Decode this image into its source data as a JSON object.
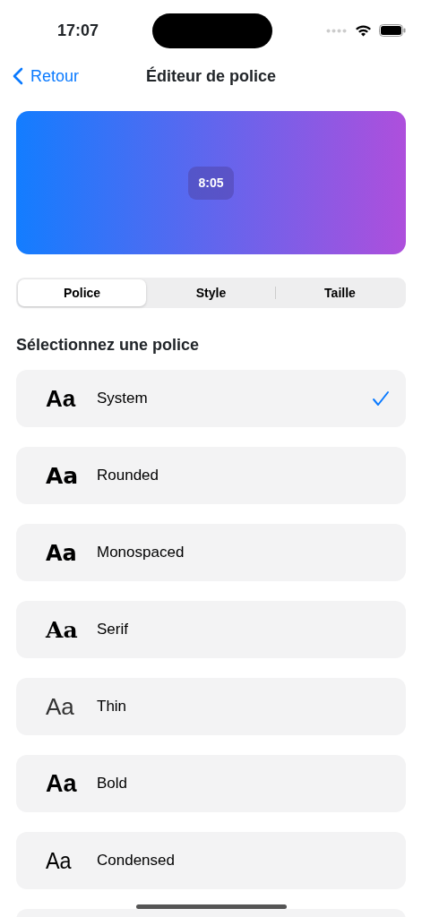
{
  "status_bar": {
    "time": "17:07"
  },
  "nav": {
    "back": "Retour",
    "title": "Éditeur de police"
  },
  "preview": {
    "time": "8:05"
  },
  "tabs": [
    {
      "label": "Police",
      "selected": true
    },
    {
      "label": "Style",
      "selected": false
    },
    {
      "label": "Taille",
      "selected": false
    }
  ],
  "section_title": "Sélectionnez une police",
  "fonts": [
    {
      "sample": "Aa",
      "name": "System",
      "kind": "system",
      "selected": true
    },
    {
      "sample": "Aa",
      "name": "Rounded",
      "kind": "rounded",
      "selected": false
    },
    {
      "sample": "Aa",
      "name": "Monospaced",
      "kind": "monospaced",
      "selected": false
    },
    {
      "sample": "Aa",
      "name": "Serif",
      "kind": "serif",
      "selected": false
    },
    {
      "sample": "Aa",
      "name": "Thin",
      "kind": "thin",
      "selected": false
    },
    {
      "sample": "Aa",
      "name": "Bold",
      "kind": "bold",
      "selected": false
    },
    {
      "sample": "Aa",
      "name": "Condensed",
      "kind": "condensed",
      "selected": false
    }
  ]
}
